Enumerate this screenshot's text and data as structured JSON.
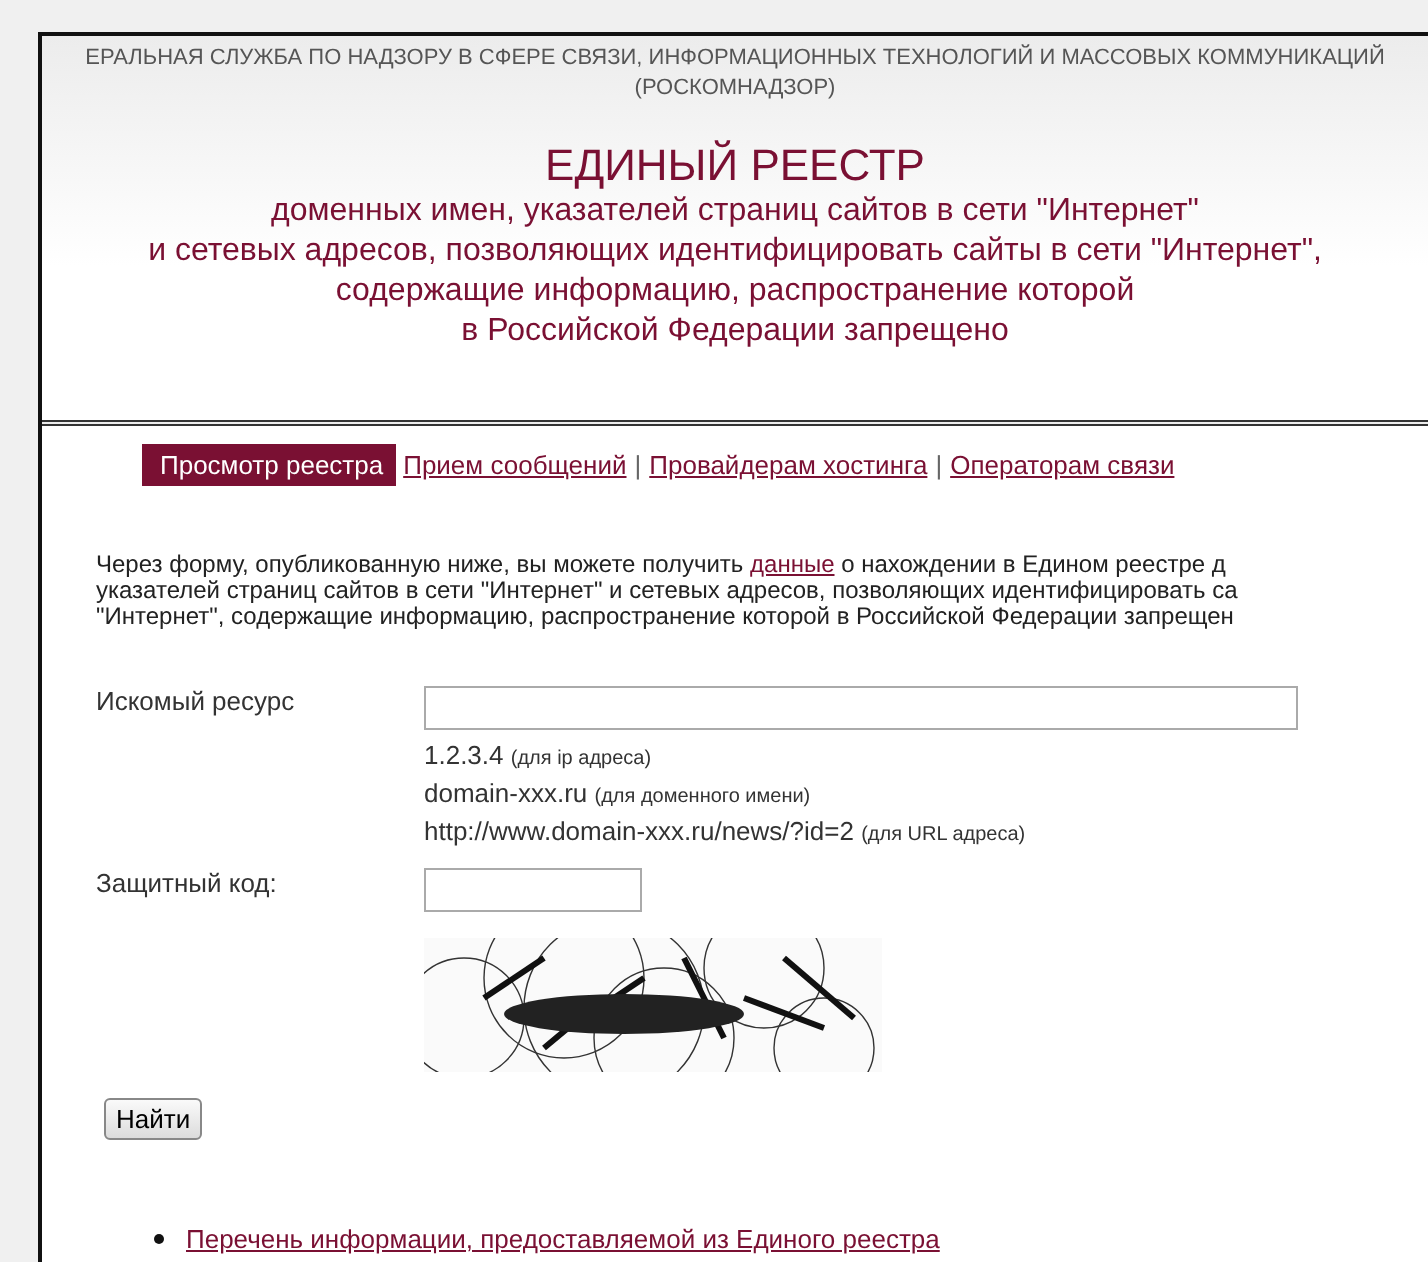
{
  "header": {
    "agency": "ЕРАЛЬНАЯ СЛУЖБА ПО НАДЗОРУ В СФЕРЕ СВЯЗИ, ИНФОРМАЦИОННЫХ ТЕХНОЛОГИЙ И МАССОВЫХ КОММУНИКАЦИЙ",
    "agency_short": "(РОСКОМНАДЗОР)",
    "title": "ЕДИНЫЙ РЕЕСТР",
    "subtitle": [
      "доменных имен, указателей страниц сайтов в сети \"Интернет\"",
      "и сетевых адресов, позволяющих идентифицировать сайты в сети \"Интернет\",",
      "содержащие информацию, распространение которой",
      "в Российской Федерации запрещено"
    ]
  },
  "nav": [
    {
      "label": "Просмотр реестра",
      "selected": true
    },
    {
      "label": "Прием сообщений",
      "selected": false
    },
    {
      "label": "Провайдерам хостинга",
      "selected": false
    },
    {
      "label": "Операторам связи",
      "selected": false
    }
  ],
  "nav_separator": "|",
  "intro": {
    "before": "Через форму, опубликованную ниже, вы можете получить ",
    "link": "данные",
    "after": " о нахождении в Едином реестре д",
    "lines": [
      "указателей страниц сайтов в сети \"Интернет\" и сетевых адресов, позволяющих идентифицировать са",
      "\"Интернет\", содержащие информацию, распространение которой в Российской Федерации запрещен"
    ]
  },
  "form": {
    "resource_label": "Искомый ресурс",
    "examples": [
      {
        "value": "1.2.3.4",
        "note": "(для ip адреса)"
      },
      {
        "value": "domain-xxx.ru",
        "note": "(для доменного имени)"
      },
      {
        "value": "http://www.domain-xxx.ru/news/?id=2",
        "note": "(для URL адреса)"
      }
    ],
    "code_label": "Защитный код:",
    "submit": "Найти"
  },
  "links": [
    "Перечень информации, предоставляемой из Единого реестра"
  ]
}
